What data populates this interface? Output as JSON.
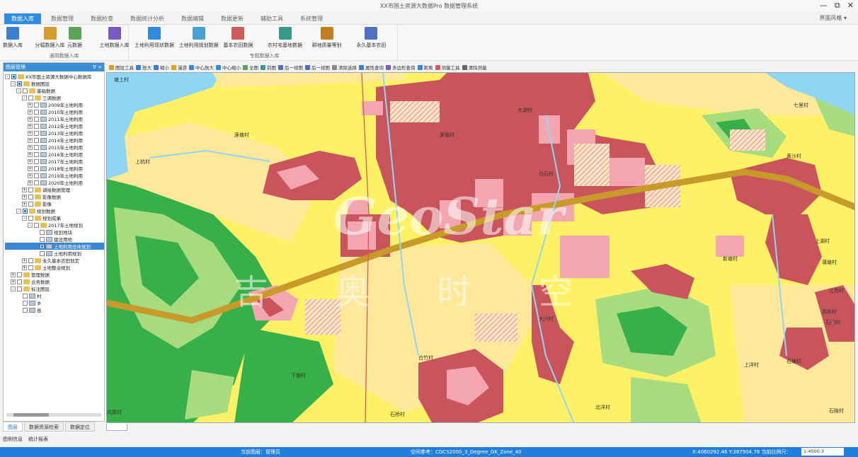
{
  "window": {
    "title": "XX市国土资源大数据Pro 数据管理系统",
    "controls": [
      "—",
      "⧉",
      "✕"
    ]
  },
  "tabs": [
    {
      "label": "数据入库",
      "active": true
    },
    {
      "label": "数据管理",
      "active": false
    },
    {
      "label": "数据检查",
      "active": false
    },
    {
      "label": "数据统计分析",
      "active": false
    },
    {
      "label": "数据编辑",
      "active": false
    },
    {
      "label": "数据更新",
      "active": false
    },
    {
      "label": "辅助工具",
      "active": false
    },
    {
      "label": "系统管理",
      "active": false
    }
  ],
  "skin_label": "界面风格 ▾",
  "ribbon": {
    "groups": [
      {
        "label": "通用数据入库",
        "buttons": [
          "数据入库",
          "分幅数据入库",
          "元数据",
          "土地数据入库"
        ]
      },
      {
        "label": "专题数据入库",
        "buttons": [
          "土地利用现状数据",
          "土地利用规划数据",
          "基本农田数据",
          "农村宅基地数据",
          "耕地质量等别",
          "永久基本农田"
        ]
      }
    ]
  },
  "panel": {
    "title": "图层管理",
    "tree": [
      {
        "depth": 0,
        "exp": "-",
        "chk": true,
        "icon": "fold",
        "label": "XX市国土资源大数据中心数据库"
      },
      {
        "depth": 1,
        "exp": "-",
        "chk": true,
        "icon": "fold",
        "label": "数据图层"
      },
      {
        "depth": 2,
        "exp": "-",
        "chk": false,
        "icon": "fold",
        "label": "基础数据"
      },
      {
        "depth": 3,
        "exp": "-",
        "chk": false,
        "icon": "fold",
        "label": "三调数据"
      },
      {
        "depth": 4,
        "exp": "+",
        "chk": false,
        "icon": "lay",
        "label": "2009年土地利用"
      },
      {
        "depth": 4,
        "exp": "+",
        "chk": false,
        "icon": "lay",
        "label": "2010年土地利用"
      },
      {
        "depth": 4,
        "exp": "+",
        "chk": false,
        "icon": "lay",
        "label": "2011年土地利用"
      },
      {
        "depth": 4,
        "exp": "+",
        "chk": false,
        "icon": "lay",
        "label": "2012年土地利用"
      },
      {
        "depth": 4,
        "exp": "+",
        "chk": false,
        "icon": "lay",
        "label": "2013年土地利用"
      },
      {
        "depth": 4,
        "exp": "+",
        "chk": false,
        "icon": "lay",
        "label": "2014年土地利用"
      },
      {
        "depth": 4,
        "exp": "+",
        "chk": false,
        "icon": "lay",
        "label": "2015年土地利用"
      },
      {
        "depth": 4,
        "exp": "+",
        "chk": false,
        "icon": "lay",
        "label": "2016年土地利用"
      },
      {
        "depth": 4,
        "exp": "+",
        "chk": false,
        "icon": "lay",
        "label": "2017年土地利用"
      },
      {
        "depth": 4,
        "exp": "+",
        "chk": false,
        "icon": "lay",
        "label": "2018年土地利用"
      },
      {
        "depth": 4,
        "exp": "+",
        "chk": false,
        "icon": "lay",
        "label": "2019年土地利用"
      },
      {
        "depth": 4,
        "exp": "+",
        "chk": false,
        "icon": "lay",
        "label": "2020年土地利用"
      },
      {
        "depth": 3,
        "exp": "+",
        "chk": false,
        "icon": "fold",
        "label": "调绘数据管理"
      },
      {
        "depth": 3,
        "exp": "+",
        "chk": false,
        "icon": "fold",
        "label": "影像数据"
      },
      {
        "depth": 3,
        "exp": "+",
        "chk": false,
        "icon": "fold",
        "label": "影像"
      },
      {
        "depth": 2,
        "exp": "-",
        "chk": true,
        "icon": "fold",
        "label": "规划数据"
      },
      {
        "depth": 3,
        "exp": "-",
        "chk": false,
        "icon": "fold",
        "label": "规划成果"
      },
      {
        "depth": 4,
        "exp": "-",
        "chk": false,
        "icon": "fold",
        "label": "2017年土地规划"
      },
      {
        "depth": 5,
        "exp": "",
        "chk": false,
        "icon": "lay",
        "label": "规划地块"
      },
      {
        "depth": 5,
        "exp": "",
        "chk": false,
        "icon": "lay",
        "label": "建设用地"
      },
      {
        "depth": 5,
        "exp": "",
        "chk": true,
        "icon": "lay",
        "label": "土地利用总体规划",
        "selected": true
      },
      {
        "depth": 5,
        "exp": "",
        "chk": false,
        "icon": "lay",
        "label": "土地利用规划"
      },
      {
        "depth": 3,
        "exp": "+",
        "chk": false,
        "icon": "fold",
        "label": "永久基本农田划定"
      },
      {
        "depth": 3,
        "exp": "+",
        "chk": false,
        "icon": "fold",
        "label": "土地整治规划"
      },
      {
        "depth": 1,
        "exp": "+",
        "chk": false,
        "icon": "fold",
        "label": "管理数据"
      },
      {
        "depth": 1,
        "exp": "+",
        "chk": false,
        "icon": "fold",
        "label": "业务数据"
      },
      {
        "depth": 1,
        "exp": "-",
        "chk": false,
        "icon": "fold",
        "label": "标注图层"
      },
      {
        "depth": 2,
        "exp": "",
        "chk": false,
        "icon": "lay",
        "label": "村"
      },
      {
        "depth": 2,
        "exp": "",
        "chk": false,
        "icon": "lay",
        "label": "乡"
      },
      {
        "depth": 2,
        "exp": "",
        "chk": false,
        "icon": "lay",
        "label": "县"
      }
    ],
    "bottom_tabs": [
      "图层",
      "数据资源检索",
      "数据定位"
    ]
  },
  "map_toolbar": [
    "图层工具",
    "放大",
    "缩小",
    "漫游",
    "中心放大",
    "中心缩小",
    "全图",
    "前图",
    "后一视图",
    "后一视图",
    "清除选择",
    "属性查询",
    "多边形查询",
    "距离",
    "测量工具",
    "清除测量"
  ],
  "map": {
    "labels": [
      "塘上村",
      "莲塘村",
      "上杭村",
      "大湖村",
      "黄塘村",
      "乌石村",
      "七里村",
      "黄沙村",
      "上湖村",
      "蒲塘村",
      "新塘村",
      "高岭村",
      "石门村",
      "江西村",
      "石塘村",
      "白竹村",
      "下塘村",
      "上洋村",
      "北洋村",
      "石陂村",
      "大兴村",
      "坑尾村",
      "石桥村"
    ],
    "watermark": {
      "brand": "GeoStar",
      "cn": "吉 奥 时 空"
    }
  },
  "footer_links": [
    "图例信息",
    "统计报表"
  ],
  "status": {
    "left": "当前图层：管理员",
    "mid": "空间参考：CGCS2000_3_Degree_GK_Zone_40",
    "coords": "X:4060292.46  Y:387904.78  当前比例尺：",
    "scale": "1:4500.3"
  },
  "colors": {
    "accent": "#1f7fdd",
    "yellow": "#fff166",
    "lightyellow": "#ffe89a",
    "green": "#38b04a",
    "lightgreen": "#a6dc7e",
    "red": "#c9545c",
    "pink": "#f3a6b0",
    "water": "#8ed6f4",
    "road": "#c89a2a"
  }
}
